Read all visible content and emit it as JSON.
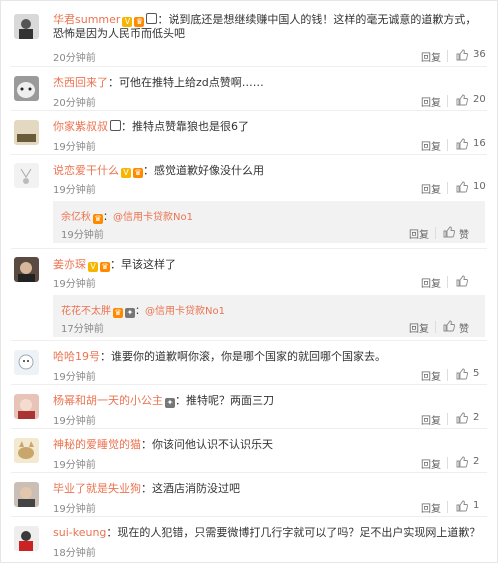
{
  "reply_label": "回复",
  "comments": [
    {
      "user": "华君summer",
      "text": "说到底还是想继续赚中国人的钱！这样的毫无诚意的道歉方式，恐怖是因为人民币而低头吧",
      "time": "20分钟前",
      "likes": "36"
    },
    {
      "user": "杰西回来了",
      "text": "可他在推特上给zd点赞啊……",
      "time": "20分钟前",
      "likes": "20"
    },
    {
      "user": "你家紫叔叔",
      "text": "推特点赞靠狼也是很6了",
      "time": "19分钟前",
      "likes": "16"
    },
    {
      "user": "说恋爱干什么",
      "text": "感觉道歉好像没什么用",
      "time": "19分钟前",
      "likes": "10",
      "sub": {
        "user": "余亿秋",
        "text": "@信用卡贷款No1",
        "time": "19分钟前",
        "likes": "赞"
      }
    },
    {
      "user": "姜亦琛",
      "text": "早该这样了",
      "time": "19分钟前",
      "likes": "",
      "sub": {
        "user": "花花不太胖",
        "text": "@信用卡贷款No1",
        "time": "17分钟前",
        "likes": "赞"
      }
    },
    {
      "user": "哈哈19号",
      "text": "谁要你的道歉啊你滚，你是哪个国家的就回哪个国家去。",
      "time": "19分钟前",
      "likes": "5"
    },
    {
      "user": "杨幂和胡一天的小公主",
      "text": "推特呢？两面三刀",
      "time": "19分钟前",
      "likes": "2"
    },
    {
      "user": "神秘的爱睡觉的猫",
      "text": "你该问他认识不认识乐天",
      "time": "19分钟前",
      "likes": "2"
    },
    {
      "user": "毕业了就是失业狗",
      "text": "这酒店消防没过吧",
      "time": "19分钟前",
      "likes": "1"
    },
    {
      "user": "sui-keung",
      "text": "现在的人犯错，只需要微博打几行字就可以了吗？足不出户实现网上道歉？",
      "time": "18分钟前",
      "likes": ""
    }
  ]
}
